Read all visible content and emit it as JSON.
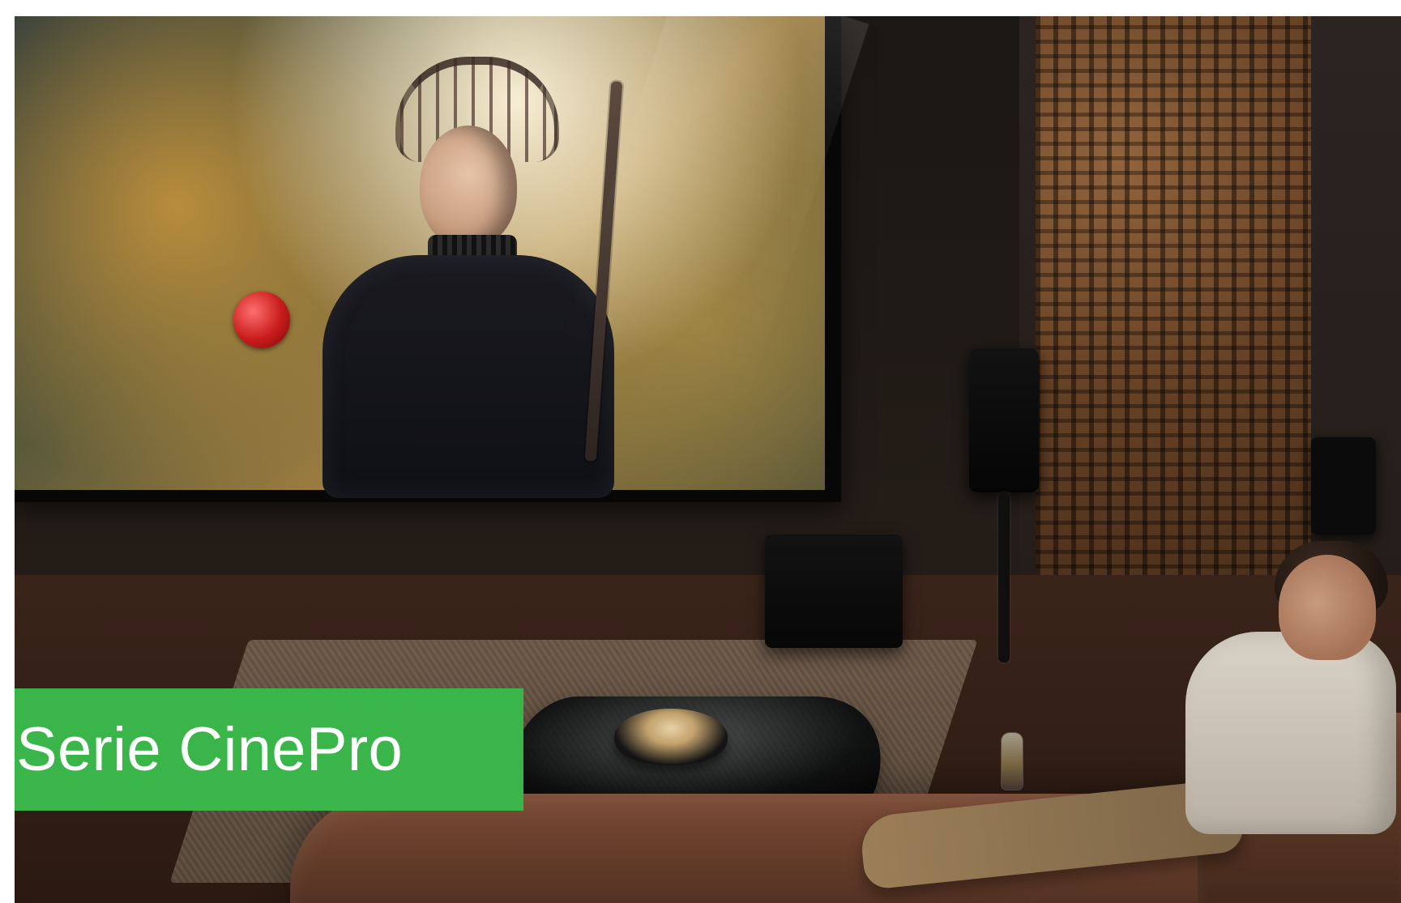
{
  "banner": {
    "title": "Serie CinePro",
    "bg_color": "#39b54a",
    "text_color": "#ffffff"
  }
}
